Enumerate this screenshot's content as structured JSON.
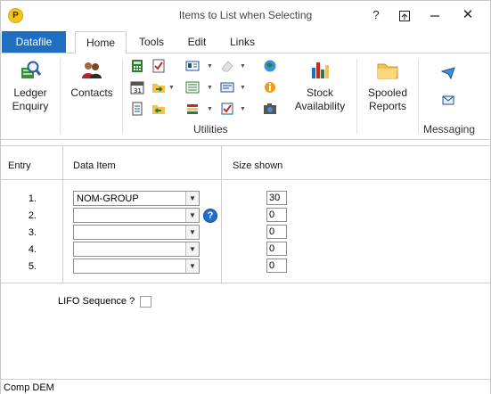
{
  "window": {
    "title": "Items to List when Selecting",
    "logo_letter": "P",
    "help_glyph": "?",
    "close_glyph": "✕"
  },
  "tabs": [
    {
      "label": "Datafile"
    },
    {
      "label": "Home"
    },
    {
      "label": "Tools"
    },
    {
      "label": "Edit"
    },
    {
      "label": "Links"
    }
  ],
  "ribbon": {
    "ledger_enquiry": {
      "line1": "Ledger",
      "line2": "Enquiry",
      "icon": "ledger-search-icon"
    },
    "contacts": {
      "label": "Contacts",
      "icon": "contacts-icon"
    },
    "utilities_label": "Utilities",
    "stock_availability": {
      "line1": "Stock",
      "line2": "Availability",
      "icon": "bar-chart-icon"
    },
    "spooled_reports": {
      "line1": "Spooled",
      "line2": "Reports",
      "icon": "folder-icon"
    },
    "messaging_label": "Messaging"
  },
  "grid": {
    "headers": {
      "entry": "Entry",
      "data_item": "Data Item",
      "size_shown": "Size shown"
    },
    "rows": [
      {
        "num": "1.",
        "item": "NOM-GROUP",
        "size": "30"
      },
      {
        "num": "2.",
        "item": "",
        "size": "0"
      },
      {
        "num": "3.",
        "item": "",
        "size": "0"
      },
      {
        "num": "4.",
        "item": "",
        "size": "0"
      },
      {
        "num": "5.",
        "item": "",
        "size": "0"
      }
    ],
    "help_glyph": "?"
  },
  "lifo": {
    "label": "LIFO Sequence ?",
    "checked": false
  },
  "status": {
    "text": "Comp DEM"
  },
  "colors": {
    "accent": "#1e6fc1",
    "help": "#1f6fd0",
    "logo": "#f5c518"
  }
}
